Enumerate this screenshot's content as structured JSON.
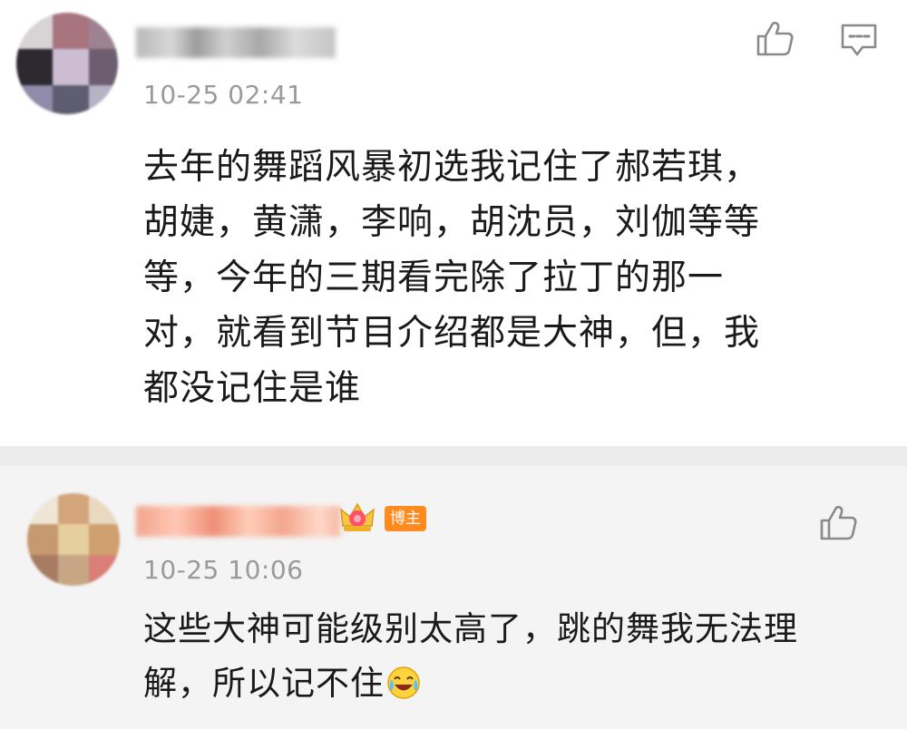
{
  "comments": [
    {
      "time": "10-25 02:41",
      "text_lines": [
        "去年的舞蹈风暴初选我记住了郝若琪，",
        "胡婕，黄潇，李响，胡沈员，刘伽等等",
        "等，今年的三期看完除了拉丁的那一",
        "对，就看到节目介绍都是大神，但，我",
        "都没记住是谁"
      ],
      "icons": [
        "thumbs-up-icon",
        "reply-icon"
      ]
    },
    {
      "badge": "博主",
      "time": "10-25 10:06",
      "text_lines": [
        "这些大神可能级别太高了，跳的舞我无法理",
        "解，所以记不住"
      ],
      "emoji": "laugh-cry-emoji",
      "icons": [
        "thumbs-up-icon",
        "crown-icon"
      ]
    }
  ],
  "colors": {
    "time": "#9a9a9a",
    "badge": "#ff8a1f",
    "reply_bg": "#f4f4f4",
    "separator": "#ececec"
  }
}
